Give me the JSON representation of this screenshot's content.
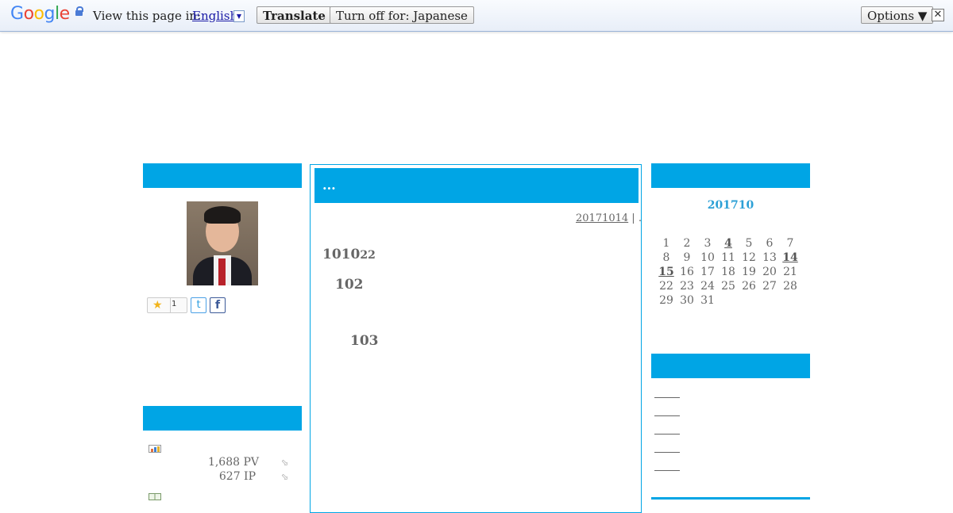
{
  "translate_bar": {
    "logo": "Google",
    "view_text": "View this page in:",
    "language": "English",
    "translate_label": "Translate",
    "turn_off_label": "Turn off for: Japanese",
    "options_label": "Options ▼",
    "close_glyph": "✕"
  },
  "left": {
    "star_count": "1",
    "twitter_glyph": "t",
    "facebook_glyph": "f",
    "stats": [
      {
        "value": "1,688 PV"
      },
      {
        "value": "627 IP"
      }
    ]
  },
  "article": {
    "title": "...",
    "date_link": "20171014",
    "date_suffix": " | .",
    "line1_main": "1010",
    "line1_small": "22",
    "line2": "102",
    "line3": "103"
  },
  "calendar": {
    "title": "201710",
    "weeks": [
      [
        "1",
        "2",
        "3",
        "4",
        "5",
        "6",
        "7"
      ],
      [
        "8",
        "9",
        "10",
        "11",
        "12",
        "13",
        "14"
      ],
      [
        "15",
        "16",
        "17",
        "18",
        "19",
        "20",
        "21"
      ],
      [
        "22",
        "23",
        "24",
        "25",
        "26",
        "27",
        "28"
      ],
      [
        "29",
        "30",
        "31",
        "",
        "",
        "",
        ""
      ]
    ],
    "linked_days": [
      "4",
      "14",
      "15"
    ]
  },
  "colors": {
    "accent": "#00a5e5",
    "calendar_title": "#2ca0d6"
  }
}
